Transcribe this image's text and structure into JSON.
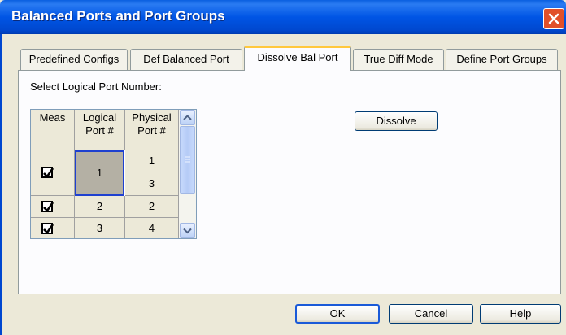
{
  "window": {
    "title": "Balanced Ports and Port Groups"
  },
  "tabs": [
    {
      "label": "Predefined Configs"
    },
    {
      "label": "Def Balanced Port"
    },
    {
      "label": "Dissolve Bal Port",
      "active": true
    },
    {
      "label": "True Diff Mode"
    },
    {
      "label": "Define Port Groups"
    }
  ],
  "panel": {
    "select_label": "Select Logical Port Number:",
    "dissolve_label": "Dissolve"
  },
  "grid": {
    "headers": {
      "meas": "Meas",
      "logical_line1": "Logical",
      "logical_line2": "Port #",
      "physical_line1": "Physical",
      "physical_line2": "Port #"
    },
    "rows": [
      {
        "meas": true,
        "logical": "1",
        "physical": [
          "1",
          "3"
        ],
        "selected": true
      },
      {
        "meas": true,
        "logical": "2",
        "physical": [
          "2"
        ]
      },
      {
        "meas": true,
        "logical": "3",
        "physical": [
          "4"
        ]
      }
    ]
  },
  "footer": {
    "ok_label": "OK",
    "cancel_label": "Cancel",
    "help_label": "Help"
  },
  "colors": {
    "title_bar": "#0055e5",
    "close_button": "#e1502a",
    "active_tab_highlight": "#ffc83c",
    "selected_cell": "#b4b0a4",
    "selection_border": "#1e40d0"
  }
}
